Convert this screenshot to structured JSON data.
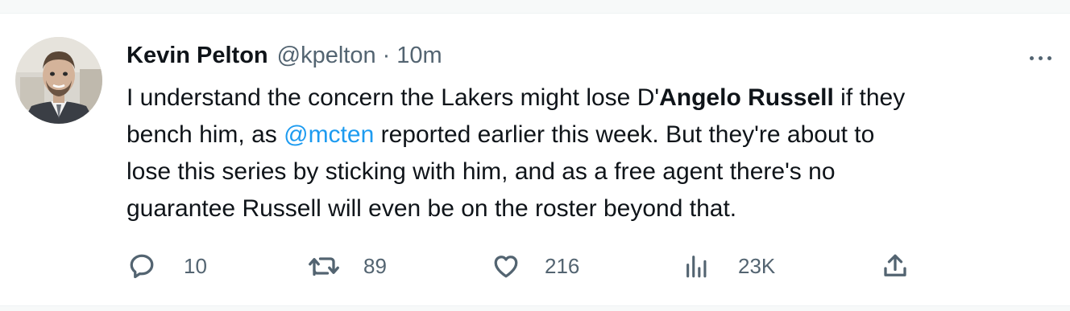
{
  "tweet": {
    "author": {
      "display_name": "Kevin Pelton",
      "handle": "@kpelton",
      "separator": "·",
      "timestamp": "10m"
    },
    "text": {
      "line1_a": "I understand the concern the Lakers might lose D'",
      "line1_b": "Angelo Russell",
      "line1_c": " if they",
      "line2_a": "bench him, as ",
      "line2_mention": "@mcten",
      "line2_b": " reported earlier this week. But they're about to",
      "line3": "lose this series by sticking with him, and as a free agent there's no",
      "line4": "guarantee Russell will even be on the roster beyond that."
    },
    "actions": {
      "replies": "10",
      "retweets": "89",
      "likes": "216",
      "views": "23K"
    },
    "icons": {
      "more": "more-icon",
      "reply": "reply-icon",
      "retweet": "retweet-icon",
      "like": "heart-icon",
      "views": "views-icon",
      "share": "share-icon"
    },
    "colors": {
      "mention": "#1d9bf0",
      "secondary_text": "#536471",
      "primary_text": "#0f1419"
    }
  }
}
